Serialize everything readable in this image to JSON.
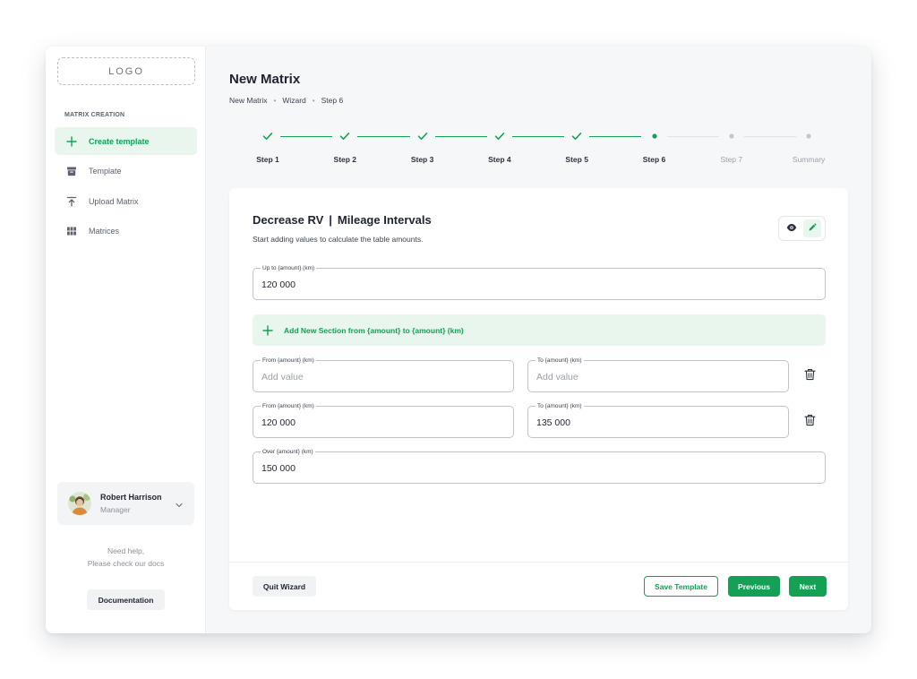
{
  "colors": {
    "accent": "#14a055",
    "accent_light": "#e8f6ee",
    "pending": "#c3c8cf"
  },
  "sidebar": {
    "logo": "LOGO",
    "section_label": "MATRIX CREATION",
    "items": [
      {
        "label": "Create template",
        "icon": "plus-icon",
        "active": true
      },
      {
        "label": "Template",
        "icon": "archive-icon",
        "active": false
      },
      {
        "label": "Upload Matrix",
        "icon": "upload-icon",
        "active": false
      },
      {
        "label": "Matrices",
        "icon": "grid-icon",
        "active": false
      }
    ],
    "user": {
      "name": "Robert Harrison",
      "role": "Manager"
    },
    "help_line1": "Need help,",
    "help_line2": "Please check our docs",
    "documentation": "Documentation"
  },
  "header": {
    "title": "New Matrix",
    "breadcrumb": [
      "New Matrix",
      "Wizard",
      "Step 6"
    ]
  },
  "stepper": {
    "current": 5,
    "steps": [
      {
        "label": "Step 1",
        "status": "done"
      },
      {
        "label": "Step 2",
        "status": "done"
      },
      {
        "label": "Step 3",
        "status": "done"
      },
      {
        "label": "Step 4",
        "status": "done"
      },
      {
        "label": "Step 5",
        "status": "done"
      },
      {
        "label": "Step 6",
        "status": "current"
      },
      {
        "label": "Step 7",
        "status": "pending"
      },
      {
        "label": "Summary",
        "status": "pending"
      }
    ]
  },
  "card": {
    "title_left": "Decrease RV",
    "title_sep": "|",
    "title_right": "Mileage Intervals",
    "subtitle": "Start adding values to calculate the table amounts.",
    "up_to": {
      "label": "Up to {amount} (km)",
      "value": "120 000"
    },
    "add_section": "Add New Section from {amount} to {amount} (km)",
    "rows": [
      {
        "from": {
          "label": "From {amount} (km)",
          "value": "",
          "placeholder": "Add value"
        },
        "to": {
          "label": "To {amount} (km)",
          "value": "",
          "placeholder": "Add value"
        }
      },
      {
        "from": {
          "label": "From {amount} (km)",
          "value": "120 000",
          "placeholder": ""
        },
        "to": {
          "label": "To {amount} (km)",
          "value": "135 000",
          "placeholder": ""
        }
      }
    ],
    "over": {
      "label": "Over {amount} (km)",
      "value": "150 000"
    }
  },
  "footer": {
    "quit": "Quit Wizard",
    "save": "Save Template",
    "previous": "Previous",
    "next": "Next"
  }
}
